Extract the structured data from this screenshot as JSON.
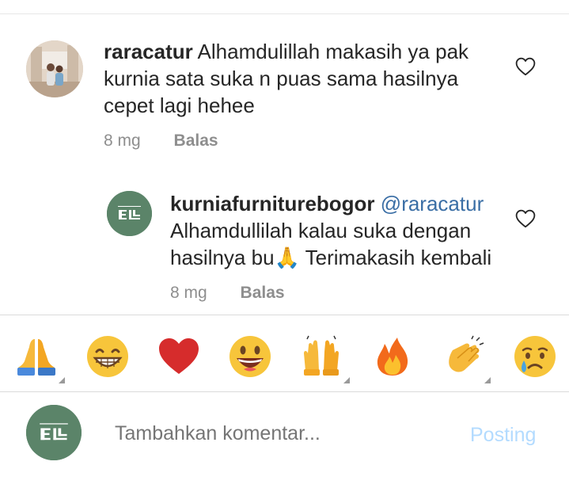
{
  "comments": [
    {
      "username": "raracatur",
      "text": "Alhamdulillah makasih ya pak kurnia sata suka n puas sama hasilnya cepet lagi hehee",
      "time": "8 mg",
      "reply_label": "Balas",
      "avatar": "user-photo-avatar"
    },
    {
      "username": "kurniafurniturebogor",
      "mention": "@raracatur",
      "text": "Alhamdullilah kalau suka dengan hasilnya bu🙏 Terimakasih kembali",
      "time": "8 mg",
      "reply_label": "Balas",
      "avatar": "kurnia-furniture-logo-avatar"
    }
  ],
  "quick_emojis": [
    "🙏",
    "😁",
    "❤️",
    "😀",
    "🙌",
    "🔥",
    "👏",
    "😢"
  ],
  "composer": {
    "placeholder": "Tambahkan komentar...",
    "post_label": "Posting"
  },
  "colors": {
    "brand_green": "#5b8469",
    "post_disabled": "#b3dbff",
    "mention": "#3a6ea5",
    "secondary_text": "#8e8e8e"
  }
}
